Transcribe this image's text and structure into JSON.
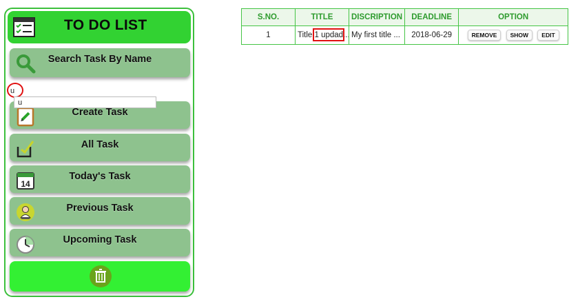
{
  "sidebar": {
    "app_title": "TO DO LIST",
    "search_label": "Search Task By Name",
    "search_value": "u",
    "suggestion": "u",
    "items": [
      {
        "label": "Create Task",
        "icon": "clipboard-pencil-icon"
      },
      {
        "label": "All Task",
        "icon": "checkbox-icon"
      },
      {
        "label": "Today's Task",
        "icon": "calendar-icon",
        "calendar_day": "14"
      },
      {
        "label": "Previous Task",
        "icon": "person-icon"
      },
      {
        "label": "Upcoming Task",
        "icon": "clock-icon"
      }
    ],
    "delete_icon": "trash-icon"
  },
  "table": {
    "headers": [
      "S.NO.",
      "TITLE",
      "DISCRIPTION",
      "DEADLINE",
      "OPTION"
    ],
    "rows": [
      {
        "sno": "1",
        "title": "Title 1 updad...",
        "description": "My first title ...",
        "deadline": "2018-06-29",
        "actions": [
          "REMOVE",
          "SHOW",
          "EDIT"
        ]
      }
    ]
  },
  "colors": {
    "header_green": "#32d232",
    "menu_green": "#8ec28e",
    "trash_green": "#33f033",
    "table_header_text": "#2e9b2e",
    "highlight_red": "#e01010"
  }
}
